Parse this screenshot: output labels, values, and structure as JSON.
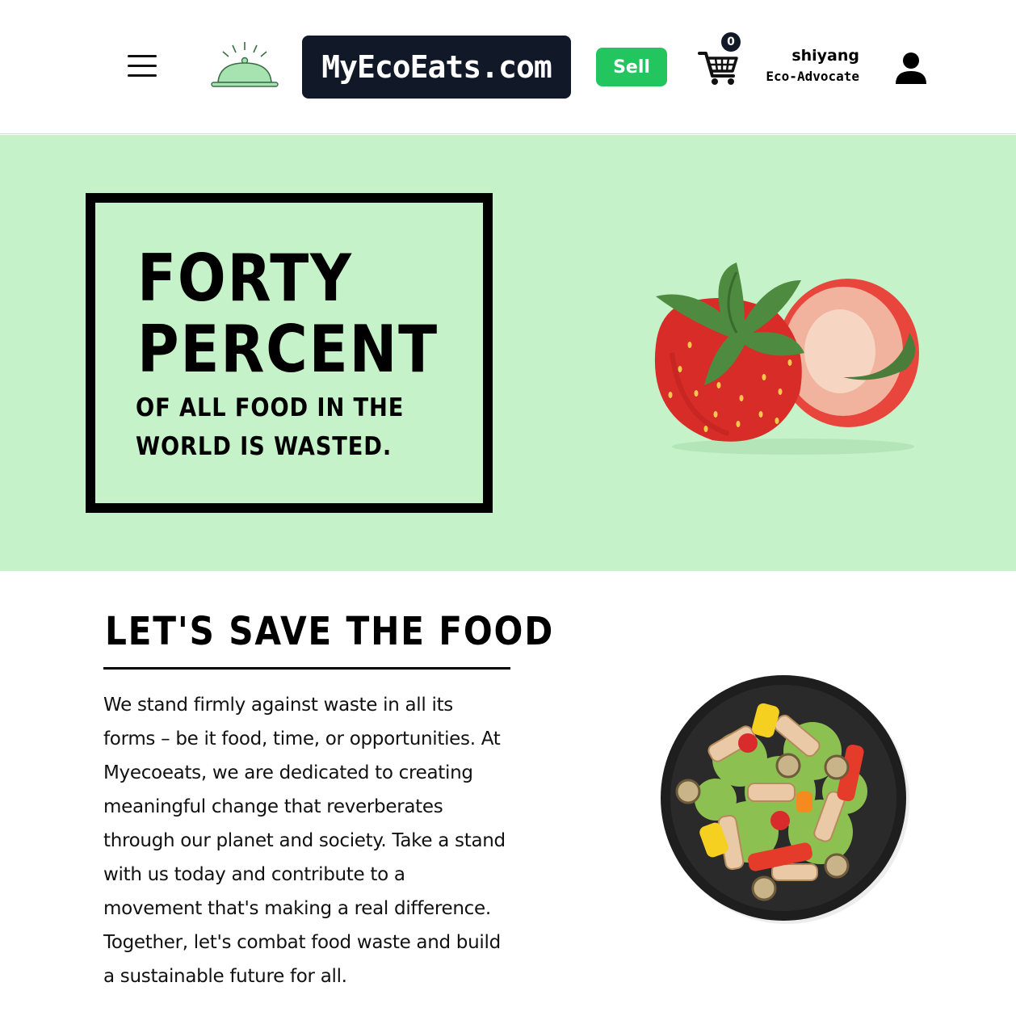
{
  "header": {
    "menu_icon": "hamburger-icon",
    "logo_icon": "cloche-icon",
    "brand": "MyEcoEats.com",
    "sell_label": "Sell",
    "cart_icon": "shopping-cart-icon",
    "cart_count": "0",
    "user": {
      "name": "shiyang",
      "role": "Eco-Advocate",
      "avatar_icon": "user-icon"
    }
  },
  "hero": {
    "line1": "FORTY",
    "line2": "PERCENT",
    "subtext": "OF ALL FOOD IN THE WORLD IS WASTED.",
    "image": "strawberry-image"
  },
  "save_section": {
    "title": "LET'S SAVE THE FOOD",
    "body": "We stand firmly against waste in all its forms – be it food, time, or opportunities. At Myecoeats, we are dedicated to creating meaningful change that reverberates through our planet and society. Take a stand with us today and contribute to a movement that's making a real difference. Together, let's combat food waste and build a sustainable future for all.",
    "image": "salad-plate-image"
  },
  "colors": {
    "hero_bg": "#c5f2c8",
    "brand_bg": "#111827",
    "sell_green": "#22c55e",
    "cloche_green": "#a7e3b0"
  }
}
